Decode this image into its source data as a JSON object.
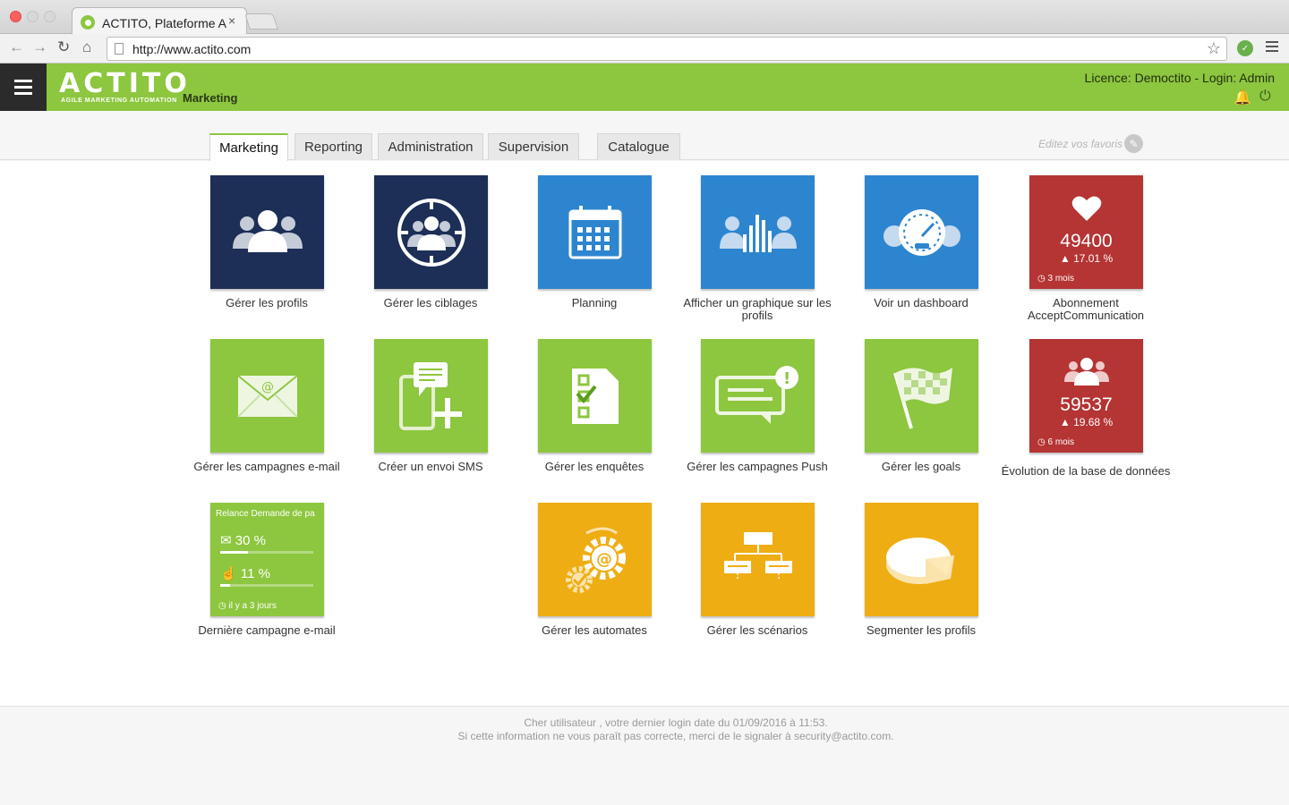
{
  "browser": {
    "tab_title": "ACTITO, Plateforme A",
    "tab_close": "×",
    "url": "http://www.actito.com",
    "back_icon": "←",
    "forward_icon": "→",
    "reload_icon": "↻",
    "home_icon": "⌂",
    "star_icon": "☆",
    "extension_icon": "✓"
  },
  "header": {
    "logo": "ACTITO",
    "tagline": "AGILE MARKETING AUTOMATION",
    "module": "Marketing",
    "licence": "Licence: Democtito - Login: Admin",
    "bell_icon": "🔔",
    "power_icon": "⏻"
  },
  "tabs": [
    "Marketing",
    "Reporting",
    "Administration",
    "Supervision",
    "Catalogue"
  ],
  "favorites": {
    "label": "Editez vos favoris",
    "icon": "wrench-icon"
  },
  "tiles": [
    {
      "label": "Gérer les profils",
      "color": "#1d2e57",
      "icon": "users-icon"
    },
    {
      "label": "Gérer les ciblages",
      "color": "#1d2e57",
      "icon": "target-users-icon"
    },
    {
      "label": "Planning",
      "color": "#2e85cf",
      "icon": "calendar-icon"
    },
    {
      "label": "Afficher un graphique sur les profils",
      "color": "#2e85cf",
      "icon": "users-chart-icon"
    },
    {
      "label": "Voir un dashboard",
      "color": "#2e85cf",
      "icon": "gauge-icon"
    },
    {
      "label": "Abonnement AcceptCommunication",
      "color": "#b53434",
      "icon": "heart-icon",
      "value": "49400",
      "percent": "17.01 %",
      "period": "3 mois"
    },
    {
      "label": "Gérer les campagnes e-mail",
      "color": "#8dc63f",
      "icon": "envelope-icon"
    },
    {
      "label": "Créer un envoi SMS",
      "color": "#8dc63f",
      "icon": "sms-icon"
    },
    {
      "label": "Gérer les enquêtes",
      "color": "#8dc63f",
      "icon": "survey-icon"
    },
    {
      "label": "Gérer les campagnes Push",
      "color": "#8dc63f",
      "icon": "push-icon"
    },
    {
      "label": "Gérer les goals",
      "color": "#8dc63f",
      "icon": "flag-icon"
    },
    {
      "label": "Évolution de la base de données",
      "color": "#b53434",
      "icon": "users-icon",
      "value": "59537",
      "percent": "19.68 %",
      "period": "6 mois"
    },
    {
      "label": "Dernière campagne e-mail",
      "color": "#8dc63f",
      "icon": "email-stats",
      "title": "Relance Demande de pa",
      "open_rate": "30 %",
      "open_fraction": 0.3,
      "click_rate": "11 %",
      "click_fraction": 0.11,
      "period": "il y a 3 jours"
    },
    {
      "label": "Gérer les automates",
      "color": "#efad14",
      "icon": "gears-icon"
    },
    {
      "label": "Gérer les scénarios",
      "color": "#efad14",
      "icon": "flowchart-icon"
    },
    {
      "label": "Segmenter les profils",
      "color": "#efad14",
      "icon": "pie-icon"
    }
  ],
  "footer": {
    "line1": "Cher utilisateur , votre dernier login date du 01/09/2016 à 11:53.",
    "line2": "Si cette information ne vous paraît pas correcte, merci de le signaler à security@actito.com."
  }
}
